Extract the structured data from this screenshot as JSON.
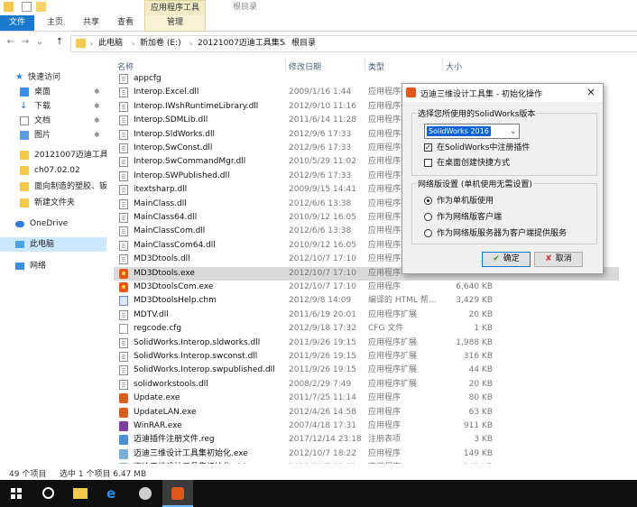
{
  "ribbon": {
    "context_tab": "应用程序工具",
    "title": "根目录",
    "tabs": [
      "文件",
      "主页",
      "共享",
      "查看",
      "管理"
    ]
  },
  "address": {
    "crumbs": [
      "此电脑",
      "新加卷 (E:)",
      "20121007迈迪工具集5",
      "根目录"
    ]
  },
  "nav": {
    "items": [
      {
        "label": "快速访问",
        "pinned": false
      },
      {
        "label": "桌面",
        "pinned": true
      },
      {
        "label": "下载",
        "pinned": true
      },
      {
        "label": "文档",
        "pinned": true
      },
      {
        "label": "图片",
        "pinned": true
      },
      {
        "label": "20121007迈迪工具",
        "pinned": false
      },
      {
        "label": "ch07.02.02",
        "pinned": false
      },
      {
        "label": "面向制造的塑胶、钣",
        "pinned": false
      },
      {
        "label": "新建文件夹",
        "pinned": false
      },
      {
        "label": "OneDrive",
        "pinned": false
      },
      {
        "label": "此电脑",
        "pinned": false
      },
      {
        "label": "网络",
        "pinned": false
      }
    ],
    "pin_glyph": "✱"
  },
  "columns": {
    "name": "名称",
    "date": "修改日期",
    "type": "类型",
    "size": "大小"
  },
  "files": [
    {
      "name": "appcfg",
      "date": "",
      "type": "",
      "size": "",
      "icon": "dll"
    },
    {
      "name": "Interop.Excel.dll",
      "date": "2009/1/16 1:44",
      "type": "应用程序扩展",
      "size": "",
      "icon": "dll"
    },
    {
      "name": "Interop.IWshRuntimeLibrary.dll",
      "date": "2012/9/10 11:16",
      "type": "应用程序扩",
      "size": "",
      "icon": "dll"
    },
    {
      "name": "Interop.SDMLib.dll",
      "date": "2011/6/14 11:28",
      "type": "应用程序扩",
      "size": "",
      "icon": "dll"
    },
    {
      "name": "Interop.SldWorks.dll",
      "date": "2012/9/6 17:33",
      "type": "应用程序扩",
      "size": "",
      "icon": "dll"
    },
    {
      "name": "Interop.SwConst.dll",
      "date": "2012/9/6 17:33",
      "type": "应用程序扩",
      "size": "",
      "icon": "dll"
    },
    {
      "name": "Interop.SwCommandMgr.dll",
      "date": "2010/5/29 11:02",
      "type": "应用程序扩",
      "size": "",
      "icon": "dll"
    },
    {
      "name": "Interop.SWPublished.dll",
      "date": "2012/9/6 17:33",
      "type": "应用程序扩",
      "size": "",
      "icon": "dll"
    },
    {
      "name": "itextsharp.dll",
      "date": "2009/9/15 14:41",
      "type": "应用程序扩",
      "size": "",
      "icon": "dll"
    },
    {
      "name": "MainClass.dll",
      "date": "2012/6/6 13:38",
      "type": "应用程序扩",
      "size": "",
      "icon": "dll"
    },
    {
      "name": "MainClass64.dll",
      "date": "2010/9/12 16:05",
      "type": "应用程序扩",
      "size": "",
      "icon": "dll"
    },
    {
      "name": "MainClassCom.dll",
      "date": "2012/6/6 13:38",
      "type": "应用程序扩",
      "size": "",
      "icon": "dll"
    },
    {
      "name": "MainClassCom64.dll",
      "date": "2010/9/12 16:05",
      "type": "应用程序扩",
      "size": "",
      "icon": "dll"
    },
    {
      "name": "MD3Dtools.dll",
      "date": "2012/10/7 17:10",
      "type": "应用程序扩",
      "size": "",
      "icon": "dll"
    },
    {
      "name": "MD3Dtools.exe",
      "date": "2012/10/7 17:10",
      "type": "应用程序",
      "size": "",
      "icon": "exe",
      "selected": true
    },
    {
      "name": "MD3DtoolsCom.exe",
      "date": "2012/10/7 17:10",
      "type": "应用程序",
      "size": "6,640 KB",
      "icon": "exe"
    },
    {
      "name": "MD3DtoolsHelp.chm",
      "date": "2012/9/8 14:09",
      "type": "编译的 HTML 帮...",
      "size": "3,429 KB",
      "icon": "chm"
    },
    {
      "name": "MDTV.dll",
      "date": "2011/6/19 20:01",
      "type": "应用程序扩展",
      "size": "20 KB",
      "icon": "dll"
    },
    {
      "name": "regcode.cfg",
      "date": "2012/9/18 17:32",
      "type": "CFG 文件",
      "size": "1 KB",
      "icon": "cfg"
    },
    {
      "name": "SolidWorks.Interop.sldworks.dll",
      "date": "2011/9/26 19:15",
      "type": "应用程序扩展",
      "size": "1,988 KB",
      "icon": "dll"
    },
    {
      "name": "SolidWorks.Interop.swconst.dll",
      "date": "2011/9/26 19:15",
      "type": "应用程序扩展",
      "size": "316 KB",
      "icon": "dll"
    },
    {
      "name": "SolidWorks.Interop.swpublished.dll",
      "date": "2011/9/26 19:15",
      "type": "应用程序扩展",
      "size": "44 KB",
      "icon": "dll"
    },
    {
      "name": "solidworkstools.dll",
      "date": "2008/2/29 7:49",
      "type": "应用程序扩展",
      "size": "20 KB",
      "icon": "dll"
    },
    {
      "name": "Update.exe",
      "date": "2011/7/25 11:14",
      "type": "应用程序",
      "size": "80 KB",
      "icon": "upd"
    },
    {
      "name": "UpdateLAN.exe",
      "date": "2012/4/26 14:58",
      "type": "应用程序",
      "size": "63 KB",
      "icon": "upd"
    },
    {
      "name": "WinRAR.exe",
      "date": "2007/4/18 17:31",
      "type": "应用程序",
      "size": "911 KB",
      "icon": "win"
    },
    {
      "name": "迈迪插件注册文件.reg",
      "date": "2017/12/14 23:18",
      "type": "注册表项",
      "size": "3 KB",
      "icon": "reg"
    },
    {
      "name": "迈迪三维设计工具集初始化.exe",
      "date": "2012/10/7 18:22",
      "type": "应用程序",
      "size": "149 KB",
      "icon": "setup"
    },
    {
      "name": "迈迪三维设计工具集初始化x64.exe",
      "date": "2012/10/7 18:21",
      "type": "应用程序",
      "size": "149 KB",
      "icon": "setup"
    }
  ],
  "status": {
    "count": "49 个项目",
    "selection": "选中 1 个项目  6.47 MB"
  },
  "dialog": {
    "title": "迈迪三维设计工具集 - 初始化操作",
    "close": "✕",
    "version_group": "选择您所使用的SolidWorks版本",
    "version_value": "SolidWorks 2016",
    "register_addin": "在SolidWorks中注册插件",
    "desktop_shortcut": "在桌面创建快捷方式",
    "network_group": "网络版设置 (单机使用无需设置)",
    "radio_standalone": "作为单机版使用",
    "radio_client": "作为网络版客户端",
    "radio_server": "作为网络版服务器为客户端提供服务",
    "ok": "确定",
    "cancel": "取消",
    "register_checked": true,
    "shortcut_checked": false
  }
}
